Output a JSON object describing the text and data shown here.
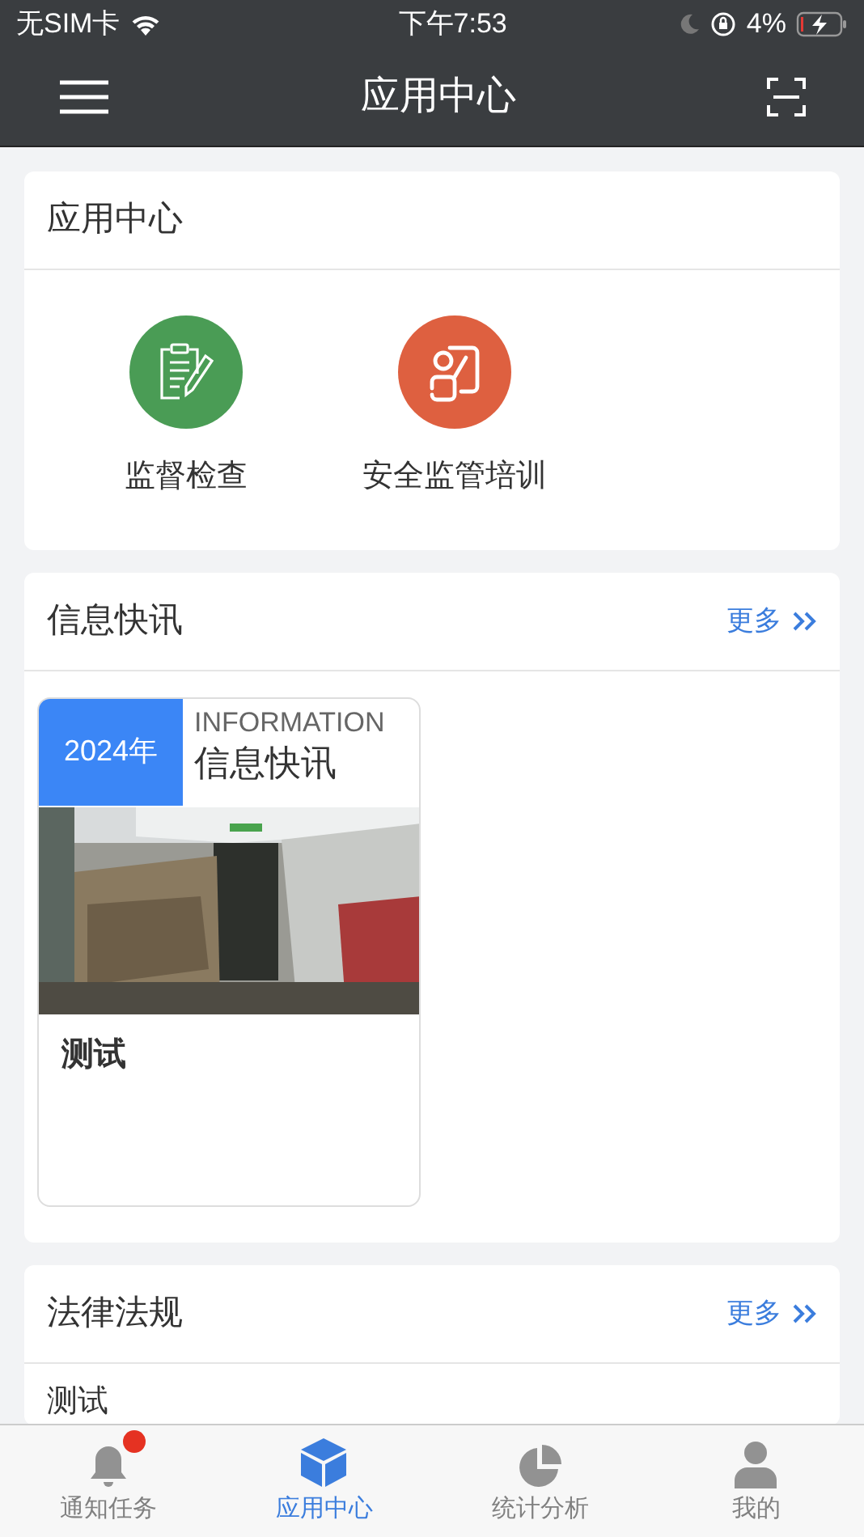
{
  "status_bar": {
    "carrier": "无SIM卡",
    "time": "下午7:53",
    "battery": "4%"
  },
  "header": {
    "title": "应用中心"
  },
  "app_section": {
    "title": "应用中心",
    "apps": [
      {
        "label": "监督检查",
        "kind": "inspection",
        "color": "#4a9c55"
      },
      {
        "label": "安全监管培训",
        "kind": "training",
        "color": "#de6040"
      }
    ]
  },
  "news_section": {
    "title": "信息快讯",
    "more": "更多",
    "cards": [
      {
        "year": "2024年",
        "tag": "INFORMATION",
        "heading": "信息快讯",
        "caption": "测试",
        "kind": "picture"
      }
    ]
  },
  "law_section": {
    "title": "法律法规",
    "more": "更多",
    "items": [
      "测试"
    ]
  },
  "tab_bar": [
    {
      "label": "通知任务",
      "kind": "bell",
      "selected": false,
      "badge": true
    },
    {
      "label": "应用中心",
      "kind": "cube",
      "selected": true,
      "badge": false
    },
    {
      "label": "统计分析",
      "kind": "pie",
      "selected": false,
      "badge": false
    },
    {
      "label": "我的",
      "kind": "person",
      "selected": false,
      "badge": false
    }
  ]
}
